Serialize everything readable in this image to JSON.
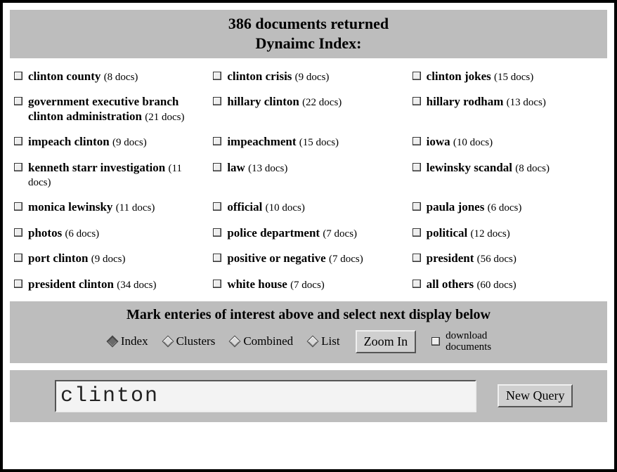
{
  "header": {
    "line1": "386 documents returned",
    "line2": "Dynaimc Index:"
  },
  "index_items": [
    {
      "label": "clinton county",
      "count": "(8 docs)"
    },
    {
      "label": "clinton crisis",
      "count": "(9 docs)"
    },
    {
      "label": "clinton jokes",
      "count": "(15 docs)"
    },
    {
      "label": "government executive branch clinton administration",
      "count": "(21 docs)"
    },
    {
      "label": "hillary clinton",
      "count": "(22 docs)"
    },
    {
      "label": "hillary rodham",
      "count": "(13 docs)"
    },
    {
      "label": "impeach clinton",
      "count": "(9 docs)"
    },
    {
      "label": "impeachment",
      "count": "(15 docs)"
    },
    {
      "label": "iowa",
      "count": "(10 docs)"
    },
    {
      "label": "kenneth starr investigation",
      "count": "(11 docs)"
    },
    {
      "label": "law",
      "count": "(13 docs)"
    },
    {
      "label": "lewinsky scandal",
      "count": "(8 docs)"
    },
    {
      "label": "monica lewinsky",
      "count": "(11 docs)"
    },
    {
      "label": "official",
      "count": "(10 docs)"
    },
    {
      "label": "paula jones",
      "count": "(6 docs)"
    },
    {
      "label": "photos",
      "count": "(6 docs)"
    },
    {
      "label": "police department",
      "count": "(7 docs)"
    },
    {
      "label": "political",
      "count": "(12 docs)"
    },
    {
      "label": "port clinton",
      "count": "(9 docs)"
    },
    {
      "label": "positive or negative",
      "count": "(7 docs)"
    },
    {
      "label": "president",
      "count": "(56 docs)"
    },
    {
      "label": "president clinton",
      "count": "(34 docs)"
    },
    {
      "label": "white house",
      "count": "(7 docs)"
    },
    {
      "label": "all others",
      "count": "(60 docs)"
    }
  ],
  "controls": {
    "title": "Mark enteries of interest above and select next display below",
    "options": {
      "index": "Index",
      "clusters": "Clusters",
      "combined": "Combined",
      "list": "List"
    },
    "selected_option": "index",
    "zoom_button": "Zoom In",
    "download_label": "download documents"
  },
  "query": {
    "value": "clinton",
    "button": "New Query"
  }
}
